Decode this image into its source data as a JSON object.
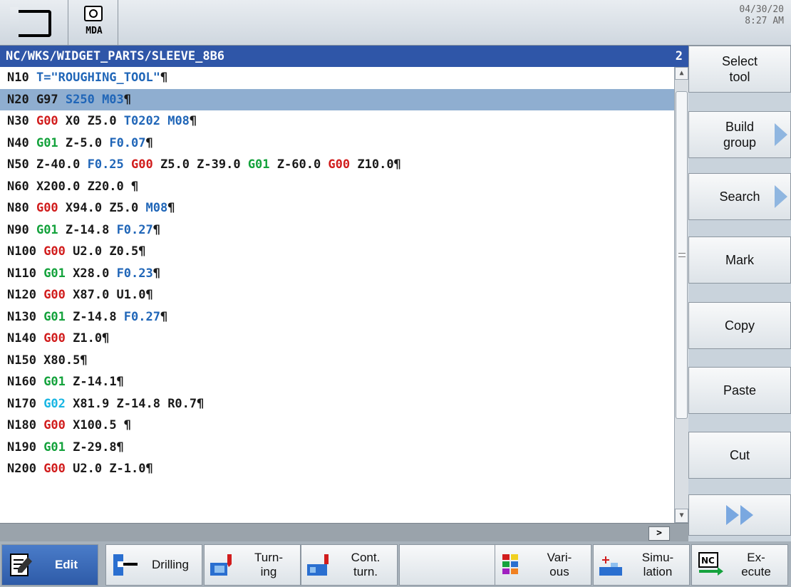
{
  "status": {
    "mode_label": "MDA",
    "date": "04/30/20",
    "time": "8:27 AM"
  },
  "editor": {
    "path": "NC/WKS/WIDGET_PARTS/SLEEVE_8B6",
    "channel": "2",
    "lines": [
      [
        [
          "N10 ",
          "w"
        ],
        [
          "T=\"ROUGHING_TOOL\"",
          "b"
        ],
        [
          "¶",
          "w"
        ]
      ],
      [
        [
          "N20 G97 ",
          "w"
        ],
        [
          "S250 M03",
          "b"
        ],
        [
          "¶",
          "w"
        ]
      ],
      [
        [
          "N30 ",
          "w"
        ],
        [
          "G00",
          "r"
        ],
        [
          " X0 Z5.0 ",
          "w"
        ],
        [
          "T0202 M08",
          "b"
        ],
        [
          "¶",
          "w"
        ]
      ],
      [
        [
          "N40 ",
          "w"
        ],
        [
          "G01",
          "g"
        ],
        [
          " Z-5.0 ",
          "w"
        ],
        [
          "F0.07",
          "b"
        ],
        [
          "¶",
          "w"
        ]
      ],
      [
        [
          "N50 Z-40.0 ",
          "w"
        ],
        [
          "F0.25",
          "b"
        ],
        [
          " ",
          "w"
        ],
        [
          "G00",
          "r"
        ],
        [
          " Z5.0 Z-39.0 ",
          "w"
        ],
        [
          "G01",
          "g"
        ],
        [
          " Z-60.0 ",
          "w"
        ],
        [
          "G00",
          "r"
        ],
        [
          " Z10.0¶",
          "w"
        ]
      ],
      [
        [
          "N60 X200.0 Z20.0 ¶",
          "w"
        ]
      ],
      [
        [
          "N80 ",
          "w"
        ],
        [
          "G00",
          "r"
        ],
        [
          " X94.0 Z5.0 ",
          "w"
        ],
        [
          "M08",
          "b"
        ],
        [
          "¶",
          "w"
        ]
      ],
      [
        [
          "N90 ",
          "w"
        ],
        [
          "G01",
          "g"
        ],
        [
          " Z-14.8 ",
          "w"
        ],
        [
          "F0.27",
          "b"
        ],
        [
          "¶",
          "w"
        ]
      ],
      [
        [
          "N100 ",
          "w"
        ],
        [
          "G00",
          "r"
        ],
        [
          " U2.0 Z0.5¶",
          "w"
        ]
      ],
      [
        [
          "N110 ",
          "w"
        ],
        [
          "G01",
          "g"
        ],
        [
          " X28.0 ",
          "w"
        ],
        [
          "F0.23",
          "b"
        ],
        [
          "¶",
          "w"
        ]
      ],
      [
        [
          "N120 ",
          "w"
        ],
        [
          "G00",
          "r"
        ],
        [
          " X87.0 U1.0¶",
          "w"
        ]
      ],
      [
        [
          "N130 ",
          "w"
        ],
        [
          "G01",
          "g"
        ],
        [
          " Z-14.8 ",
          "w"
        ],
        [
          "F0.27",
          "b"
        ],
        [
          "¶",
          "w"
        ]
      ],
      [
        [
          "N140 ",
          "w"
        ],
        [
          "G00",
          "r"
        ],
        [
          " Z1.0¶",
          "w"
        ]
      ],
      [
        [
          "N150 X80.5¶",
          "w"
        ]
      ],
      [
        [
          "N160 ",
          "w"
        ],
        [
          "G01",
          "g"
        ],
        [
          " Z-14.1¶",
          "w"
        ]
      ],
      [
        [
          "N170 ",
          "w"
        ],
        [
          "G02",
          "c"
        ],
        [
          " X81.9 Z-14.8 R0.7¶",
          "w"
        ]
      ],
      [
        [
          "N180 ",
          "w"
        ],
        [
          "G00",
          "r"
        ],
        [
          " X100.5 ¶",
          "w"
        ]
      ],
      [
        [
          "N190 ",
          "w"
        ],
        [
          "G01",
          "g"
        ],
        [
          " Z-29.8¶",
          "w"
        ]
      ],
      [
        [
          "N200 ",
          "w"
        ],
        [
          "G00",
          "r"
        ],
        [
          " U2.0 Z-1.0¶",
          "w"
        ]
      ]
    ],
    "selected_line": 1,
    "hscroll_label": ">"
  },
  "right_softkeys": [
    {
      "line1": "Select",
      "line2": "tool",
      "arrow": false
    },
    {
      "line1": "Build",
      "line2": "group",
      "arrow": true
    },
    {
      "line1": "Search",
      "line2": "",
      "arrow": true
    },
    {
      "line1": "Mark",
      "line2": "",
      "arrow": false
    },
    {
      "line1": "Copy",
      "line2": "",
      "arrow": false
    },
    {
      "line1": "Paste",
      "line2": "",
      "arrow": false
    },
    {
      "line1": "Cut",
      "line2": "",
      "arrow": false
    }
  ],
  "bottom_softkeys": [
    {
      "line1": "Edit",
      "line2": "",
      "icon": "edit-icon",
      "active": true
    },
    {
      "line1": "Drilling",
      "line2": "",
      "icon": "drilling-icon",
      "active": false
    },
    {
      "line1": "Turn-",
      "line2": "ing",
      "icon": "turning-icon",
      "active": false
    },
    {
      "line1": "Cont.",
      "line2": "turn.",
      "icon": "contour-turning-icon",
      "active": false
    },
    {
      "line1": "",
      "line2": "",
      "icon": "",
      "active": false
    },
    {
      "line1": "Vari-",
      "line2": "ous",
      "icon": "various-icon",
      "active": false
    },
    {
      "line1": "Simu-",
      "line2": "lation",
      "icon": "simulation-icon",
      "active": false
    },
    {
      "line1": "Ex-",
      "line2": "ecute",
      "icon": "nc-execute-icon",
      "active": false
    }
  ],
  "colors": {
    "g00": "#d11d1d",
    "g01": "#14a23c",
    "g02": "#19b6e3",
    "param": "#2066b8",
    "title_bar": "#2f56a8",
    "selection": "#8faed0"
  }
}
